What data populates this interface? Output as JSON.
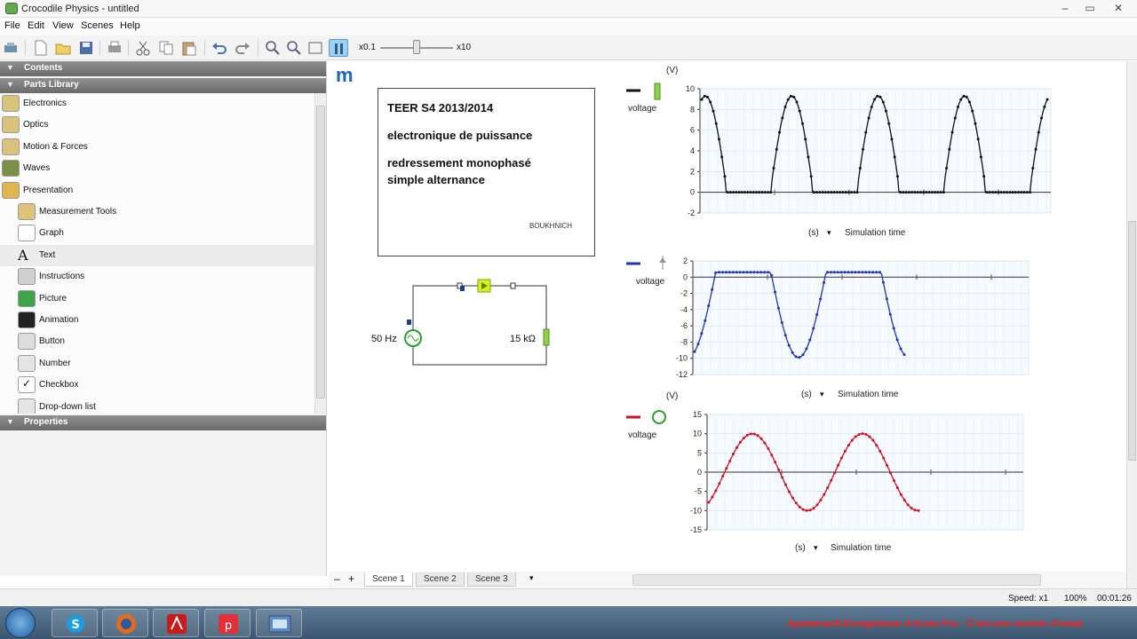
{
  "window": {
    "title": "Crocodile Physics - untitled",
    "controls": [
      "–",
      "▭",
      "✕"
    ]
  },
  "menu": {
    "items": [
      "File",
      "Edit",
      "View",
      "Scenes",
      "Help"
    ]
  },
  "toolbar": {
    "speed_min": "x0.1",
    "speed_max": "x10",
    "slider_position": 0.48,
    "icons": [
      "scene-icon",
      "new-icon",
      "open-icon",
      "save-icon",
      "print-icon",
      "cut-icon",
      "copy-icon",
      "paste-icon",
      "undo-icon",
      "redo-icon",
      "zoom-in-icon",
      "zoom-out-icon",
      "fit-icon",
      "pause-icon"
    ]
  },
  "left_panel": {
    "contents_header": "Contents",
    "library_header": "Parts Library",
    "properties_header": "Properties",
    "items": [
      {
        "label": "Electronics",
        "icon": "folder-electronics-icon",
        "level": 0
      },
      {
        "label": "Optics",
        "icon": "folder-optics-icon",
        "level": 0
      },
      {
        "label": "Motion & Forces",
        "icon": "folder-motion-icon",
        "level": 0
      },
      {
        "label": "Waves",
        "icon": "folder-waves-icon",
        "level": 0
      },
      {
        "label": "Presentation",
        "icon": "folder-open-icon",
        "level": 0
      },
      {
        "label": "Measurement Tools",
        "icon": "folder-measure-icon",
        "level": 1
      },
      {
        "label": "Graph",
        "icon": "graph-icon",
        "level": 1
      },
      {
        "label": "Text",
        "icon": "text-icon",
        "level": 1,
        "selected": true
      },
      {
        "label": "Instructions",
        "icon": "instructions-icon",
        "level": 1
      },
      {
        "label": "Picture",
        "icon": "picture-icon",
        "level": 1
      },
      {
        "label": "Animation",
        "icon": "animation-icon",
        "level": 1
      },
      {
        "label": "Button",
        "icon": "button-icon",
        "level": 1
      },
      {
        "label": "Number",
        "icon": "number-icon",
        "level": 1
      },
      {
        "label": "Checkbox",
        "icon": "checkbox-icon",
        "level": 1
      },
      {
        "label": "Drop-down list",
        "icon": "dropdown-icon",
        "level": 1
      }
    ]
  },
  "canvas": {
    "logo": "m",
    "textbox": {
      "line1": "TEER S4 2013/2014",
      "line2": "electronique de puissance",
      "line3a": "redressement monophasé",
      "line3b": "simple alternance",
      "author": "BOUKHNICH"
    },
    "circuit": {
      "source_label": "50 Hz",
      "resistor_label": "15 kΩ"
    },
    "graphs": [
      {
        "unit": "(V)",
        "legend": "voltage",
        "color": "#111111",
        "marker": "green-resistor-icon",
        "x_unit": "(s)",
        "x_label": "Simulation time",
        "yticks": [
          "10",
          "8",
          "6",
          "4",
          "2",
          "0",
          "-2"
        ]
      },
      {
        "unit": "",
        "legend": "voltage",
        "color": "#2233aa",
        "marker": "diode-icon",
        "x_unit": "(s)",
        "x_label": "Simulation time",
        "yticks": [
          "2",
          "0",
          "-2",
          "-4",
          "-6",
          "-8",
          "-10",
          "-12"
        ]
      },
      {
        "unit": "(V)",
        "legend": "voltage",
        "color": "#cc1122",
        "marker": "ac-source-icon",
        "x_unit": "(s)",
        "x_label": "Simulation time",
        "yticks": [
          "15",
          "10",
          "5",
          "0",
          "-5",
          "-10",
          "-15"
        ]
      }
    ]
  },
  "tabs": {
    "minus": "–",
    "plus": "+",
    "items": [
      "Scene 1",
      "Scene 2",
      "Scene 3"
    ],
    "more": "▾"
  },
  "status": {
    "speed": "Speed: x1",
    "zoom": "100%",
    "time": "00:01:26"
  },
  "taskbar": {
    "apps": [
      "windows-start-icon",
      "skype-icon",
      "firefox-icon",
      "acrobat-icon",
      "p-app-icon",
      "screen-recorder-icon"
    ],
    "watermark": "Apowersoft Enregistreur d'écran Pro - C'est une version d'essai"
  }
}
